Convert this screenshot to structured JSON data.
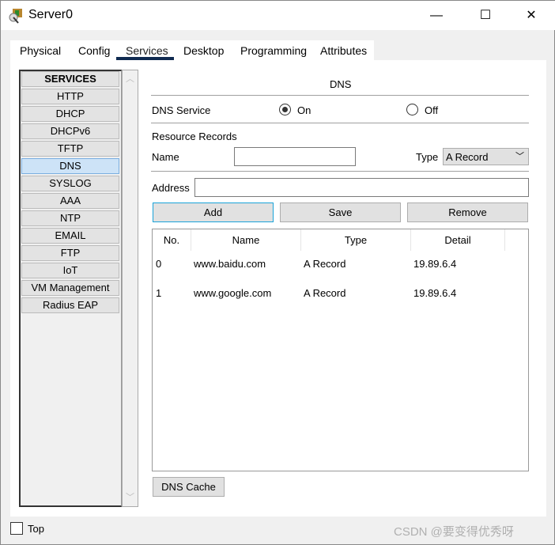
{
  "window": {
    "title": "Server0",
    "minimize": "—",
    "maximize": "☐",
    "close": "✕"
  },
  "tabs": [
    "Physical",
    "Config",
    "Services",
    "Desktop",
    "Programming",
    "Attributes"
  ],
  "active_tab": "Services",
  "sidebar": {
    "header": "SERVICES",
    "items": [
      "HTTP",
      "DHCP",
      "DHCPv6",
      "TFTP",
      "DNS",
      "SYSLOG",
      "AAA",
      "NTP",
      "EMAIL",
      "FTP",
      "IoT",
      "VM Management",
      "Radius EAP"
    ],
    "selected": "DNS"
  },
  "dns": {
    "heading": "DNS",
    "service_label": "DNS Service",
    "on_label": "On",
    "off_label": "Off",
    "service_state": "On",
    "resource_records": "Resource Records",
    "name_label": "Name",
    "name_value": "",
    "type_label": "Type",
    "type_value": "A Record",
    "address_label": "Address",
    "address_value": "",
    "add": "Add",
    "save": "Save",
    "remove": "Remove",
    "columns": [
      "No.",
      "Name",
      "Type",
      "Detail"
    ],
    "rows": [
      {
        "no": "0",
        "name": "www.baidu.com",
        "type": "A Record",
        "detail": "19.89.6.4"
      },
      {
        "no": "1",
        "name": "www.google.com",
        "type": "A Record",
        "detail": "19.89.6.4"
      }
    ],
    "dns_cache": "DNS Cache"
  },
  "footer": {
    "top_label": "Top",
    "top_checked": false
  },
  "watermark": "CSDN @要变得优秀呀"
}
